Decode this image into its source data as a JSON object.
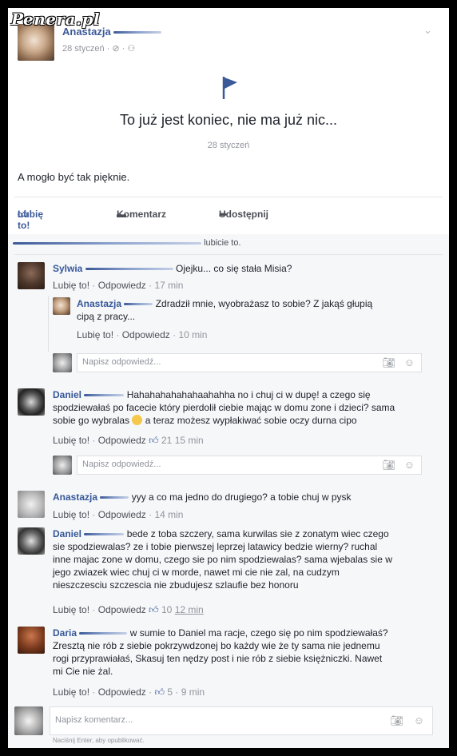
{
  "watermark": "Penera.pl",
  "post": {
    "author": "Anastazja",
    "date": "28 styczeń · ⊘ · ⚇",
    "event_title": "To już jest koniec, nie ma już nic...",
    "event_date": "28 styczeń",
    "body": "A mogło być tak pięknie."
  },
  "actions": {
    "like": "Lubię to!",
    "comment": "Komentarz",
    "share": "Udostępnij"
  },
  "likes_text": "lubicie to.",
  "comments": [
    {
      "name": "Sylwia",
      "text": "Ojejku... co się stała Misia?",
      "meta_like": "Lubię to!",
      "meta_reply": "Odpowiedz",
      "meta_time": "17 min"
    },
    {
      "name": "Anastazja",
      "text_line1": "Zdradził mnie, wyobrażasz to sobie? Z jakąś głupią",
      "text_line2": "cipą z pracy...",
      "meta_like": "Lubię to!",
      "meta_reply": "Odpowiedz",
      "meta_time": "10 min"
    },
    {
      "name": "Daniel",
      "text_line1": "Hahahahahahahaahahha no i chuj ci w dupę! a czego się",
      "text_line2": "spodziewałaś po facecie który pierdolił ciebie mając w domu zone i dzieci? sama",
      "text_line3": "sobie go wybralas",
      "text_line3b": "a teraz możesz wypłakiwać sobie oczy durna cipo",
      "meta_like": "Lubię to!",
      "meta_reply": "Odpowiedz",
      "meta_count": "21",
      "meta_time": "15 min"
    },
    {
      "name": "Anastazja",
      "text": "yyy a co ma jedno do drugiego? a tobie chuj w pysk",
      "meta_like": "Lubię to!",
      "meta_reply": "Odpowiedz",
      "meta_time": "14 min"
    },
    {
      "name": "Daniel",
      "text_line1": "bede z toba szczery, sama kurwilas sie z zonatym wiec czego",
      "text_line2": "sie spodziewalas? ze i tobie pierwszej leprzej latawicy bedzie wierny? ruchal",
      "text_line3": "inne majac zone w domu, czego sie po nim spodziewalas? sama wjebalas sie w",
      "text_line4": "jego zwiazek wiec chuj ci w morde, nawet mi cie nie zal, na cudzym",
      "text_line5": "nieszczesciu szczescia nie zbudujesz szlaufie bez honoru",
      "meta_like": "Lubię to!",
      "meta_reply": "Odpowiedz",
      "meta_count": "10",
      "meta_time": "12 min"
    },
    {
      "name": "Daria",
      "text_line1": "w sumie to Daniel ma racje, czego się po nim spodziewałaś?",
      "text_line2": "Zresztą nie rób z siebie pokrzywdzonej bo każdy wie że ty sama nie jednemu",
      "text_line3": "rogi przyprawiałaś, Skasuj ten nędzy post i nie rób z siebie księżniczki. Nawet",
      "text_line4": "mi Cie nie żal.",
      "meta_like": "Lubię to!",
      "meta_reply": "Odpowiedz",
      "meta_count": "5",
      "meta_time": "9 min"
    }
  ],
  "reply_placeholder": "Napisz odpowiedź...",
  "comment_placeholder": "Napisz komentarz...",
  "footer_note": "Naciśnij Enter, aby opublikować."
}
